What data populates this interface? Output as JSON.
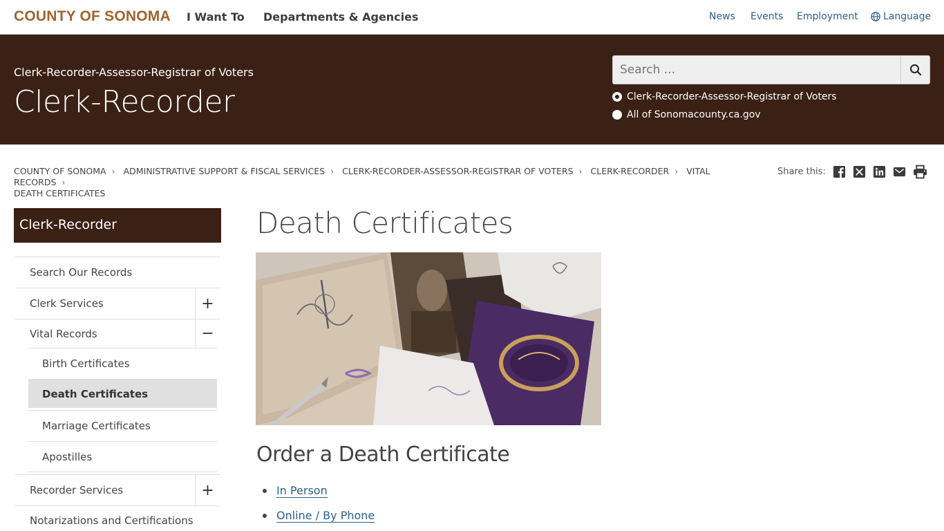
{
  "header": {
    "logo": "COUNTY OF SONOMA",
    "main_nav": [
      "I Want To",
      "Departments & Agencies"
    ],
    "utility_nav": [
      "News",
      "Events",
      "Employment",
      "Language"
    ]
  },
  "banner": {
    "department": "Clerk-Recorder-Assessor-Registrar of Voters",
    "title": "Clerk-Recorder",
    "search": {
      "placeholder": "Search ...",
      "scopes": [
        "Clerk-Recorder-Assessor-Registrar of Voters",
        "All of Sonomacounty.ca.gov"
      ],
      "selected_scope": "Clerk-Recorder-Assessor-Registrar of Voters"
    }
  },
  "breadcrumb": [
    "COUNTY OF SONOMA",
    "ADMINISTRATIVE SUPPORT & FISCAL SERVICES",
    "CLERK-RECORDER-ASSESSOR-REGISTRAR OF VOTERS",
    "CLERK-RECORDER",
    "VITAL RECORDS",
    "DEATH CERTIFICATES"
  ],
  "share": {
    "label": "Share this:",
    "icons": [
      "facebook-icon",
      "x-icon",
      "linkedin-icon",
      "email-icon",
      "print-icon"
    ]
  },
  "sidebar": {
    "title": "Clerk-Recorder",
    "items": [
      {
        "label": "Search Our Records",
        "toggle": ""
      },
      {
        "label": "Clerk Services",
        "toggle": "+"
      },
      {
        "label": "Vital Records",
        "toggle": "−"
      },
      {
        "label": "Recorder Services",
        "toggle": "+"
      },
      {
        "label": "Notarizations and Certifications",
        "toggle": ""
      }
    ],
    "sub_items": [
      {
        "label": "Birth Certificates",
        "active": false
      },
      {
        "label": "Death Certificates",
        "active": true
      },
      {
        "label": "Marriage Certificates",
        "active": false
      },
      {
        "label": "Apostilles",
        "active": false
      }
    ]
  },
  "main": {
    "title": "Death Certificates",
    "section_title": "Order a Death Certificate",
    "order_links": [
      "In Person",
      "Online / By Phone"
    ]
  },
  "colors": {
    "brand_brown": "#3b2016",
    "logo": "#a0622d",
    "link": "#2d5f8a"
  }
}
